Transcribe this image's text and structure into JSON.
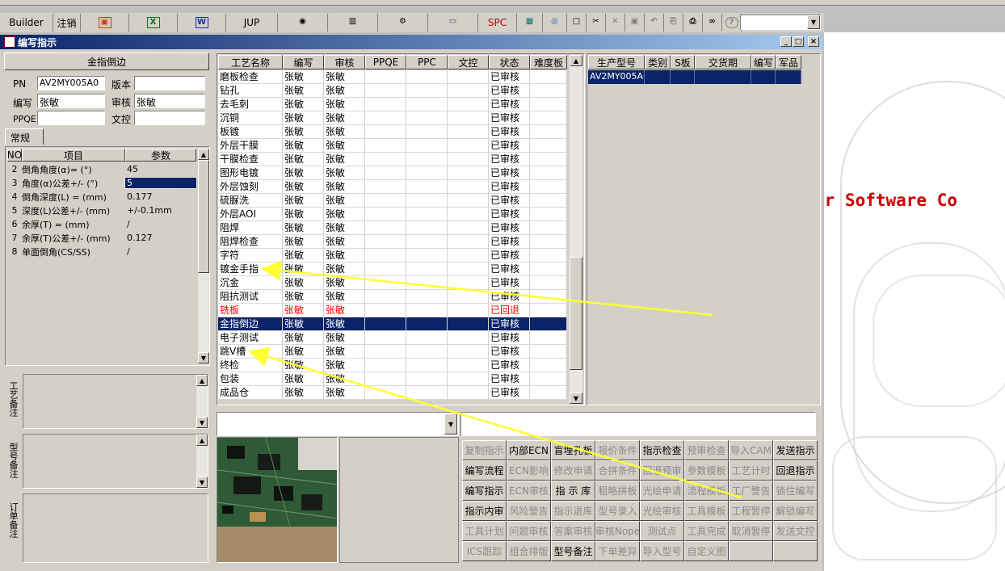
{
  "toolbar": {
    "builder_label": "Builder",
    "logout_label": "注销",
    "jup_label": "JUP",
    "spc_label": "SPC"
  },
  "window": {
    "title": "编写指示"
  },
  "left": {
    "heading": "金指倒边",
    "pn_label": "PN",
    "pn_value": "AV2MY005A0",
    "version_label": "版本",
    "version_value": "",
    "author_label": "编写",
    "author_value": "张敏",
    "reviewer_label": "审核",
    "reviewer_value": "张敏",
    "ppqe_label": "PPQE",
    "ppqe_value": "",
    "doc_control_label": "文控",
    "doc_control_value": "",
    "tab_label": "常规",
    "params_headers": [
      "NO",
      "项目",
      "参数"
    ],
    "params": [
      {
        "no": "2",
        "item": "倒角角度(α)= (°)",
        "value": "45"
      },
      {
        "no": "3",
        "item": "角度(α)公差+/- (°)",
        "value": "5"
      },
      {
        "no": "4",
        "item": "倒角深度(L) = (mm)",
        "value": "0.177"
      },
      {
        "no": "5",
        "item": "深度(L)公差+/- (mm)",
        "value": "+/-0.1mm"
      },
      {
        "no": "6",
        "item": "余厚(T) = (mm)",
        "value": "/"
      },
      {
        "no": "7",
        "item": "余厚(T)公差+/- (mm)",
        "value": "0.127"
      },
      {
        "no": "8",
        "item": "单面倒角(CS/SS)",
        "value": "/"
      }
    ],
    "memo_labels": [
      "工艺备注",
      "型号备注",
      "订单备注"
    ]
  },
  "process": {
    "headers": [
      "工艺名称",
      "编写",
      "审核",
      "PPQE",
      "PPC",
      "文控",
      "状态",
      "难度板"
    ],
    "rows": [
      {
        "name": "磨板检查",
        "author": "张敏",
        "reviewer": "张敏",
        "status": "已审核"
      },
      {
        "name": "钻孔",
        "author": "张敏",
        "reviewer": "张敏",
        "status": "已审核"
      },
      {
        "name": "去毛刺",
        "author": "张敏",
        "reviewer": "张敏",
        "status": "已审核"
      },
      {
        "name": "沉铜",
        "author": "张敏",
        "reviewer": "张敏",
        "status": "已审核"
      },
      {
        "name": "板镀",
        "author": "张敏",
        "reviewer": "张敏",
        "status": "已审核"
      },
      {
        "name": "外层干膜",
        "author": "张敏",
        "reviewer": "张敏",
        "status": "已审核"
      },
      {
        "name": "干膜检查",
        "author": "张敏",
        "reviewer": "张敏",
        "status": "已审核"
      },
      {
        "name": "图形电镀",
        "author": "张敏",
        "reviewer": "张敏",
        "status": "已审核"
      },
      {
        "name": "外层蚀刻",
        "author": "张敏",
        "reviewer": "张敏",
        "status": "已审核"
      },
      {
        "name": "硫脲洗",
        "author": "张敏",
        "reviewer": "张敏",
        "status": "已审核"
      },
      {
        "name": "外层AOI",
        "author": "张敏",
        "reviewer": "张敏",
        "status": "已审核"
      },
      {
        "name": "阻焊",
        "author": "张敏",
        "reviewer": "张敏",
        "status": "已审核"
      },
      {
        "name": "阻焊检查",
        "author": "张敏",
        "reviewer": "张敏",
        "status": "已审核"
      },
      {
        "name": "字符",
        "author": "张敏",
        "reviewer": "张敏",
        "status": "已审核"
      },
      {
        "name": "镀金手指",
        "author": "张敏",
        "reviewer": "张敏",
        "status": "已审核"
      },
      {
        "name": "沉金",
        "author": "张敏",
        "reviewer": "张敏",
        "status": "已审核"
      },
      {
        "name": "阻抗测试",
        "author": "张敏",
        "reviewer": "张敏",
        "status": "已审核"
      },
      {
        "name": "铣板",
        "author": "张敏",
        "reviewer": "张敏",
        "status": "已回退"
      },
      {
        "name": "金指倒边",
        "author": "张敏",
        "reviewer": "张敏",
        "status": "已审核"
      },
      {
        "name": "电子测试",
        "author": "张敏",
        "reviewer": "张敏",
        "status": "已审核"
      },
      {
        "name": "跳V槽",
        "author": "张敏",
        "reviewer": "张敏",
        "status": "已审核"
      },
      {
        "name": "终检",
        "author": "张敏",
        "reviewer": "张敏",
        "status": "已审核"
      },
      {
        "name": "包装",
        "author": "张敏",
        "reviewer": "张敏",
        "status": "已审核"
      },
      {
        "name": "成品仓",
        "author": "张敏",
        "reviewer": "张敏",
        "status": "已审核"
      }
    ],
    "selected_index": 18,
    "returned_index": 17
  },
  "production": {
    "headers": [
      "生产型号",
      "类别",
      "S板",
      "交货期",
      "编写",
      "军品"
    ],
    "rows": [
      {
        "model": "AV2MY005A0"
      }
    ]
  },
  "background_text": "er Software Co",
  "buttons": [
    [
      "复制指示",
      "内部ECN",
      "盲埋孔板",
      "报价条件",
      "指示检查",
      "预审检查",
      "导入CAM",
      "发送指示"
    ],
    [
      "编写流程",
      "ECN影响",
      "修改申请",
      "合拼条件",
      "回退预审",
      "参数模板",
      "工艺计时",
      "回退指示"
    ],
    [
      "编写指示",
      "ECN审核",
      "指 示 库",
      "粗略拼板",
      "光绘申请",
      "流程模板",
      "工厂警告",
      "锁住编写"
    ],
    [
      "指示内审",
      "风险警告",
      "指示退库",
      "型号录入",
      "光绘审核",
      "工具模板",
      "工程暂停",
      "解锁编写"
    ],
    [
      "工具计划",
      "问题审核",
      "答案审核",
      "审核Nope",
      "测试点",
      "工具完成",
      "取消暂停",
      "发送文控"
    ],
    [
      "ICS跟踪",
      "组合排版",
      "型号备注",
      "下单差异",
      "导入型号",
      "自定义图",
      "",
      ""
    ]
  ],
  "button_enabled": [
    [
      false,
      true,
      true,
      false,
      true,
      false,
      false,
      true
    ],
    [
      true,
      false,
      false,
      false,
      false,
      false,
      false,
      true
    ],
    [
      true,
      false,
      true,
      false,
      false,
      false,
      false,
      false
    ],
    [
      true,
      false,
      false,
      false,
      false,
      false,
      false,
      false
    ],
    [
      false,
      false,
      false,
      false,
      false,
      false,
      false,
      false
    ],
    [
      false,
      false,
      true,
      false,
      false,
      false,
      false,
      false
    ]
  ],
  "colors": {
    "selection": "#0a246a",
    "returned_text": "#ff0000",
    "annotation_arrow": "#ffff33",
    "background_text": "#cc0000"
  }
}
